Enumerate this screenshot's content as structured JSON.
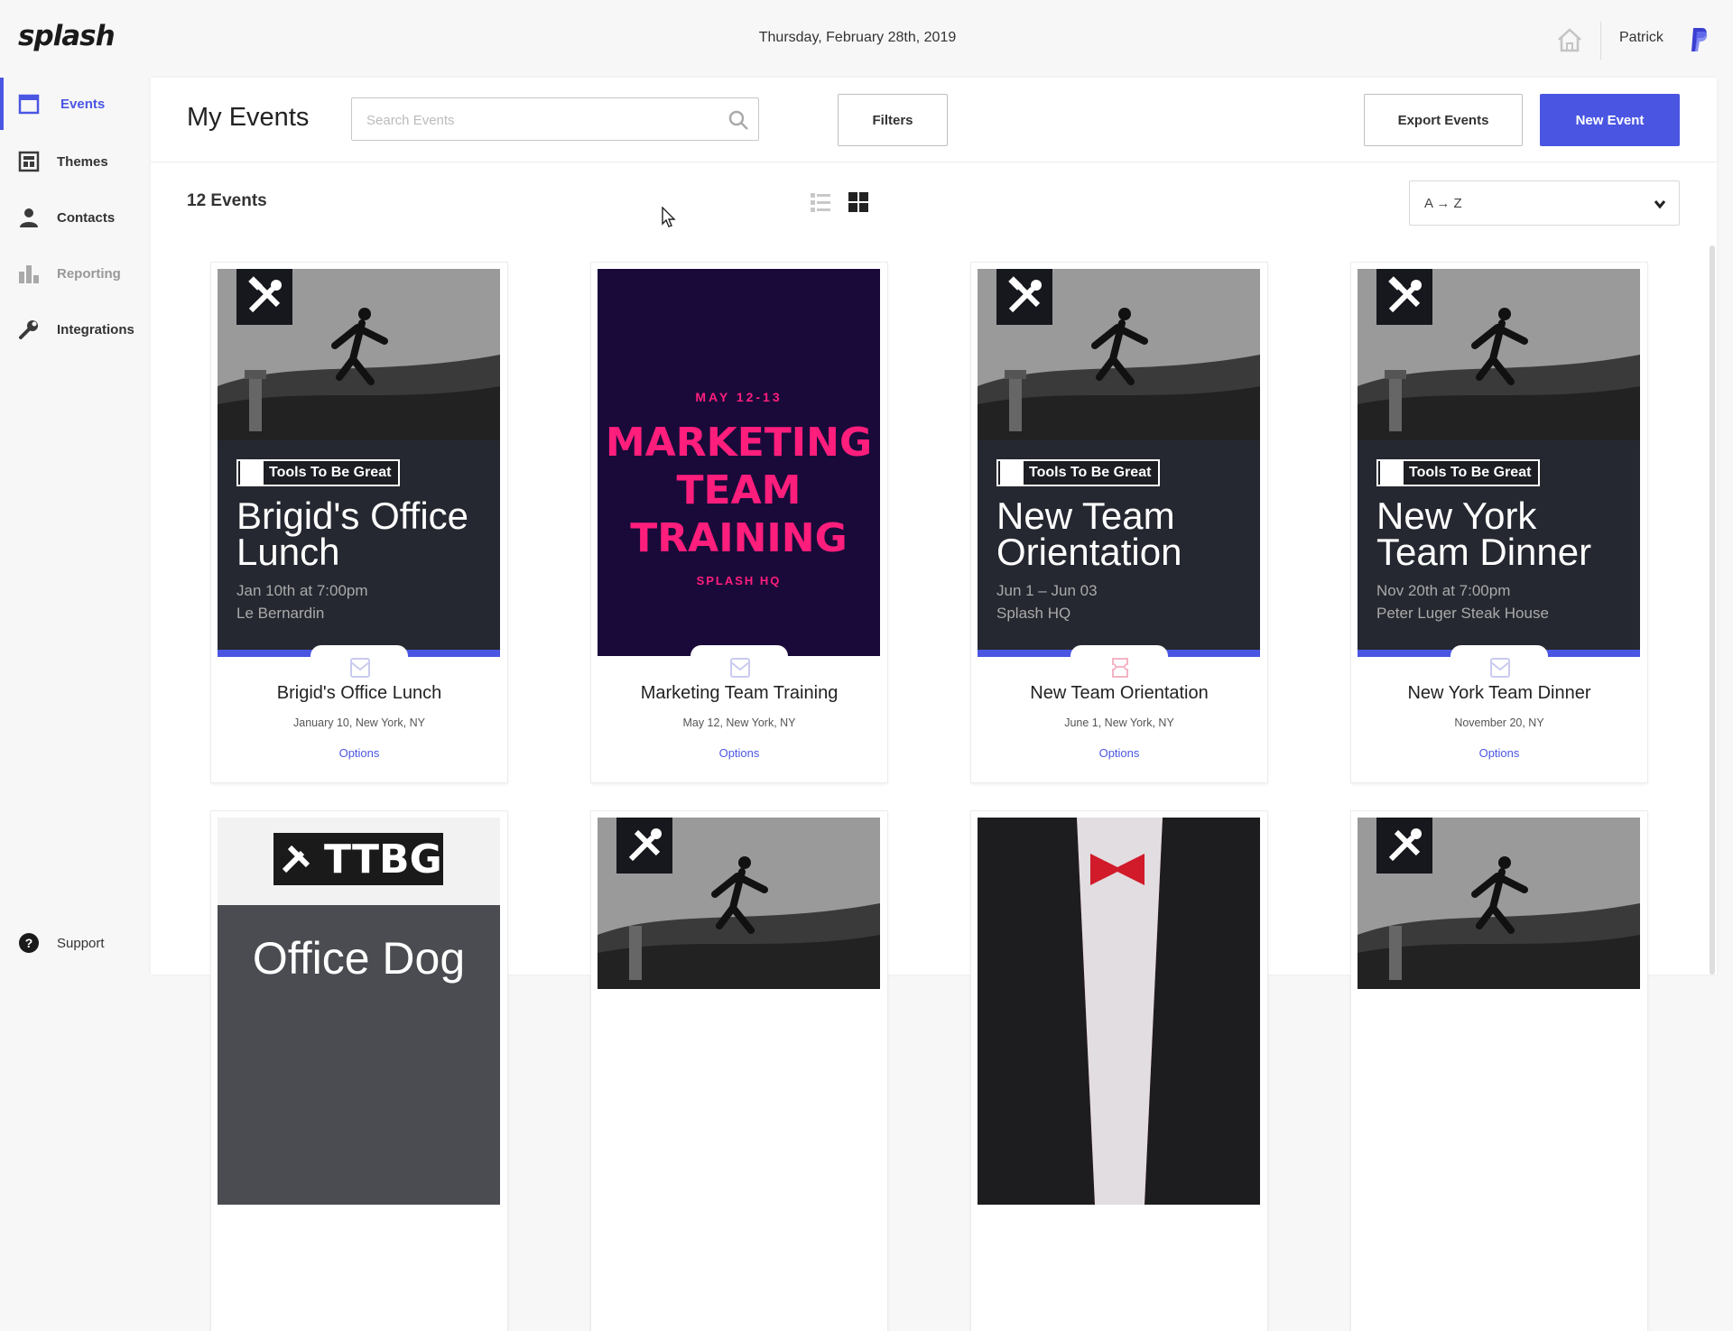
{
  "app": {
    "logo": "splash",
    "date": "Thursday, February 28th, 2019",
    "user": "Patrick"
  },
  "sidebar": {
    "items": [
      {
        "label": "Events",
        "icon": "calendar-icon",
        "active": true
      },
      {
        "label": "Themes",
        "icon": "themes-icon",
        "active": false
      },
      {
        "label": "Contacts",
        "icon": "contacts-icon",
        "active": false
      },
      {
        "label": "Reporting",
        "icon": "bar-chart-icon",
        "active": false
      },
      {
        "label": "Integrations",
        "icon": "wrench-icon",
        "active": false
      }
    ],
    "support": "Support"
  },
  "header": {
    "title": "My Events",
    "search_placeholder": "Search Events",
    "filters": "Filters",
    "export": "Export Events",
    "new_event": "New Event"
  },
  "toolbar": {
    "count": "12 Events",
    "sort": "A → Z"
  },
  "colors": {
    "accent": "#4a56e2",
    "poster_dark": "#252830",
    "marketing_bg": "#1a0a3a",
    "marketing_pink": "#ff1e7c"
  },
  "cards": [
    {
      "tag": "Tools To Be Great",
      "poster_title": "Brigid's Office Lunch",
      "poster_when": "Jan 10th at 7:00pm",
      "poster_where": "Le Bernardin",
      "title": "Brigid's Office Lunch",
      "subtitle": "January 10, New York, NY",
      "options": "Options",
      "type_icon": "mail-icon"
    },
    {
      "poster_date": "MAY 12-13",
      "poster_title": "MARKETING TEAM TRAINING",
      "poster_where": "SPLASH HQ",
      "title": "Marketing Team Training",
      "subtitle": "May 12, New York, NY",
      "options": "Options",
      "type_icon": "mail-icon"
    },
    {
      "tag": "Tools To Be Great",
      "poster_title": "New Team Orientation",
      "poster_when": "Jun 1 – Jun 03",
      "poster_where": "Splash HQ",
      "title": "New Team Orientation",
      "subtitle": "June 1, New York, NY",
      "options": "Options",
      "type_icon": "ticket-icon"
    },
    {
      "tag": "Tools To Be Great",
      "poster_title": "New York Team Dinner",
      "poster_when": "Nov 20th at 7:00pm",
      "poster_where": "Peter Luger Steak House",
      "title": "New York Team Dinner",
      "subtitle": "November 20, NY",
      "options": "Options",
      "type_icon": "mail-icon"
    }
  ],
  "row2": {
    "ttbg_logo": "TTBG",
    "ttbg_title": "Office Dog"
  }
}
